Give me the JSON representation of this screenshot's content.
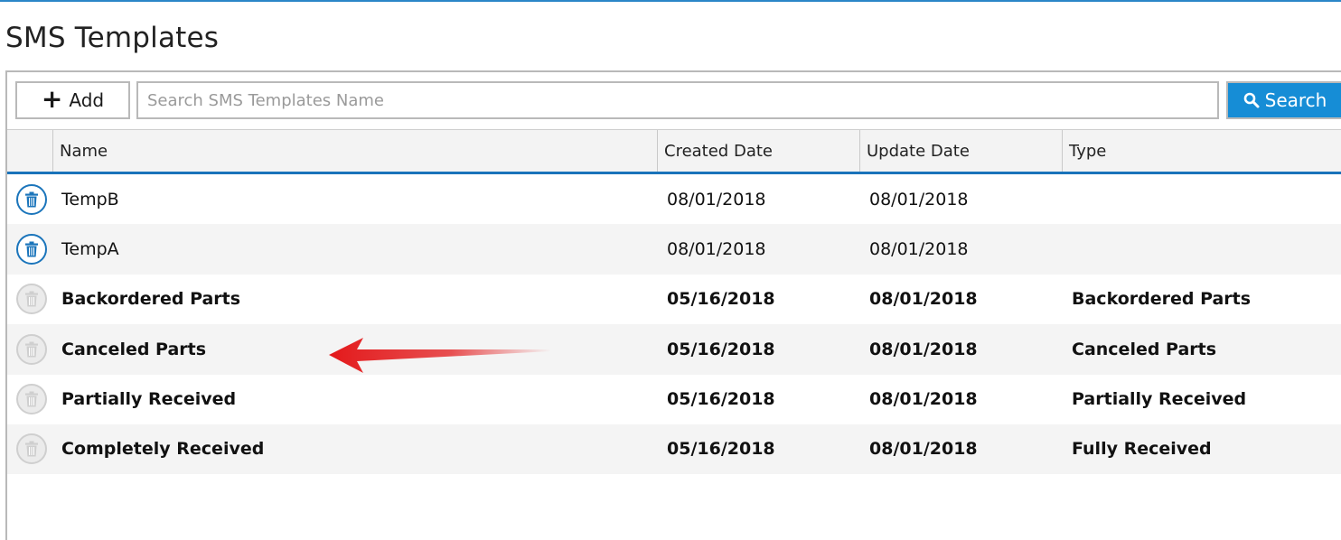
{
  "page": {
    "title": "SMS Templates"
  },
  "toolbar": {
    "add_label": "Add",
    "search_placeholder": "Search SMS Templates Name",
    "search_value": "",
    "search_label": "Search"
  },
  "columns": {
    "name": "Name",
    "created": "Created Date",
    "updated": "Update Date",
    "type": "Type"
  },
  "rows": [
    {
      "name": "TempB",
      "created": "08/01/2018",
      "updated": "08/01/2018",
      "type": "",
      "deletable": true,
      "bold": false
    },
    {
      "name": "TempA",
      "created": "08/01/2018",
      "updated": "08/01/2018",
      "type": "",
      "deletable": true,
      "bold": false
    },
    {
      "name": "Backordered Parts",
      "created": "05/16/2018",
      "updated": "08/01/2018",
      "type": "Backordered Parts",
      "deletable": false,
      "bold": true
    },
    {
      "name": "Canceled Parts",
      "created": "05/16/2018",
      "updated": "08/01/2018",
      "type": "Canceled Parts",
      "deletable": false,
      "bold": true
    },
    {
      "name": "Partially Received",
      "created": "05/16/2018",
      "updated": "08/01/2018",
      "type": "Partially Received",
      "deletable": false,
      "bold": true
    },
    {
      "name": "Completely Received",
      "created": "05/16/2018",
      "updated": "08/01/2018",
      "type": "Fully Received",
      "deletable": false,
      "bold": true
    }
  ],
  "icons": {
    "add": "plus-icon",
    "search": "search-icon",
    "delete": "trash-icon",
    "annotation": "red-arrow-icon"
  },
  "colors": {
    "accent": "#1a73ba",
    "search_button": "#168dd6",
    "delete_enabled": "#1b75bb",
    "delete_disabled": "#cfcfcf",
    "annotation_arrow": "#e3191b"
  }
}
